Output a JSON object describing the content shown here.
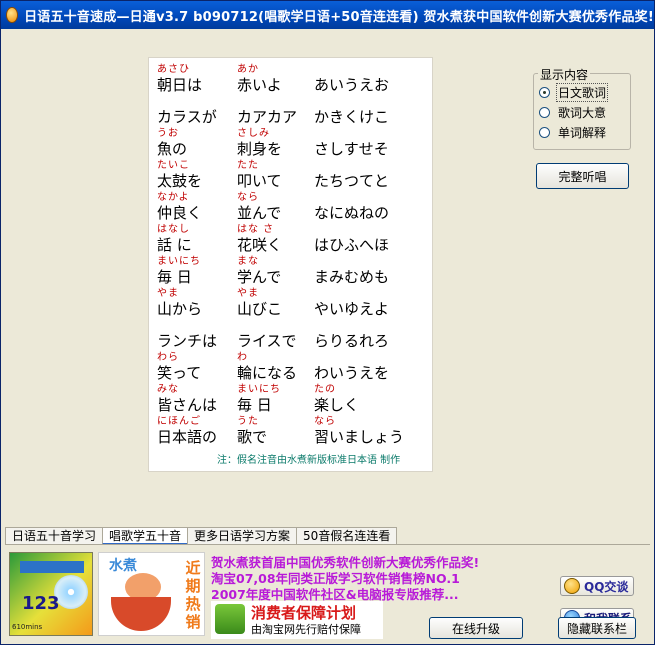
{
  "window": {
    "title": "日语五十音速成—日通v3.7 b090712(唱歌学日语+50音连连看) 贺水煮获中国软件创新大赛优秀作品奖!"
  },
  "lyrics": [
    {
      "ruby": [
        "あさひ",
        "あか",
        ""
      ],
      "text": [
        "朝日は",
        "赤いよ",
        "あいうえお"
      ]
    },
    {
      "ruby": [
        "",
        "",
        ""
      ],
      "text": [
        "カラスが",
        "カアカア",
        "かきくけこ"
      ]
    },
    {
      "ruby": [
        "うお",
        "さしみ",
        ""
      ],
      "text": [
        "魚の",
        "刺身を",
        "さしすせそ"
      ]
    },
    {
      "ruby": [
        "たいこ",
        "たた",
        ""
      ],
      "text": [
        "太鼓を",
        "叩いて",
        "たちつてと"
      ]
    },
    {
      "ruby": [
        "なかよ",
        "なら",
        ""
      ],
      "text": [
        "仲良く",
        "並んで",
        "なにぬねの"
      ]
    },
    {
      "ruby": [
        "はなし",
        "はな さ",
        ""
      ],
      "text": [
        " 話 に",
        " 花咲く",
        "はひふへほ"
      ]
    },
    {
      "ruby": [
        "まいにち",
        "まな",
        ""
      ],
      "text": [
        " 毎 日",
        " 学んで",
        " まみむめも"
      ]
    },
    {
      "ruby": [
        "やま",
        "やま",
        ""
      ],
      "text": [
        "山から",
        " 山びこ",
        " やいゆえよ"
      ]
    },
    {
      "ruby": [
        "",
        "",
        ""
      ],
      "text": [
        "ランチは",
        "ライスで",
        "らりるれろ"
      ]
    },
    {
      "ruby": [
        "わら",
        "わ",
        ""
      ],
      "text": [
        "笑って",
        "輪になる",
        "わいうえを"
      ]
    },
    {
      "ruby": [
        "みな",
        "まいにち",
        "たの"
      ],
      "text": [
        "皆さんは",
        " 毎 日",
        "  楽しく"
      ]
    },
    {
      "ruby": [
        "にほんご",
        "うた",
        "なら"
      ],
      "text": [
        "日本語の",
        "歌で",
        "習いましょう"
      ]
    }
  ],
  "lyrics_note": "注：假名注音由水煮新版标准日本语 制作",
  "display": {
    "group_title": "显示内容",
    "options": [
      {
        "label": "日文歌词",
        "selected": true
      },
      {
        "label": "歌词大意",
        "selected": false
      },
      {
        "label": "单词解释",
        "selected": false
      }
    ],
    "full_listen_label": "完整听唱"
  },
  "tabs": [
    {
      "label": "日语五十音学习",
      "active": false
    },
    {
      "label": "唱歌学五十音",
      "active": true
    },
    {
      "label": "更多日语学习方案",
      "active": false
    },
    {
      "label": "50音假名连连看",
      "active": false
    }
  ],
  "ads": {
    "book_number": "123",
    "book_caption": "610mins",
    "cartoon_brand": "水煮",
    "cartoon_tag": "近期热销",
    "promo_lines": [
      "贺水煮获首届中国优秀软件创新大赛优秀作品奖!",
      "淘宝07,08年同类正版学习软件销售榜NO.1",
      "2007年度中国软件社区&电脑报专版推荐..."
    ],
    "guard_title": "消费者保障计划",
    "guard_sub": "由淘宝网先行赔付保障"
  },
  "buttons": {
    "qq_label": "QQ交谈",
    "contact_label": "和我联系",
    "upgrade_label": "在线升级",
    "hide_label": "隐藏联系栏"
  }
}
